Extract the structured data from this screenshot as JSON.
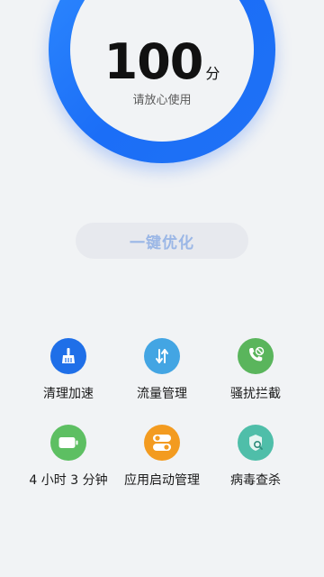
{
  "score": {
    "value": "100",
    "unit": "分",
    "subtitle": "请放心使用"
  },
  "actions": {
    "optimize_label": "一键优化"
  },
  "tiles": [
    {
      "label": "清理加速",
      "icon": "broom-icon",
      "color": "#1f6fe8"
    },
    {
      "label": "流量管理",
      "icon": "data-arrows-icon",
      "color": "#43a5e3"
    },
    {
      "label": "骚扰拦截",
      "icon": "blocked-call-icon",
      "color": "#5ab55c"
    },
    {
      "label": "4 小时 3 分钟",
      "icon": "battery-icon",
      "color": "#5dbf62"
    },
    {
      "label": "应用启动管理",
      "icon": "toggle-icon",
      "color": "#f39b20"
    },
    {
      "label": "病毒查杀",
      "icon": "shield-search-icon",
      "color": "#4fbea9"
    }
  ],
  "colors": {
    "accent": "#1f72f5",
    "background": "#f1f3f5"
  }
}
